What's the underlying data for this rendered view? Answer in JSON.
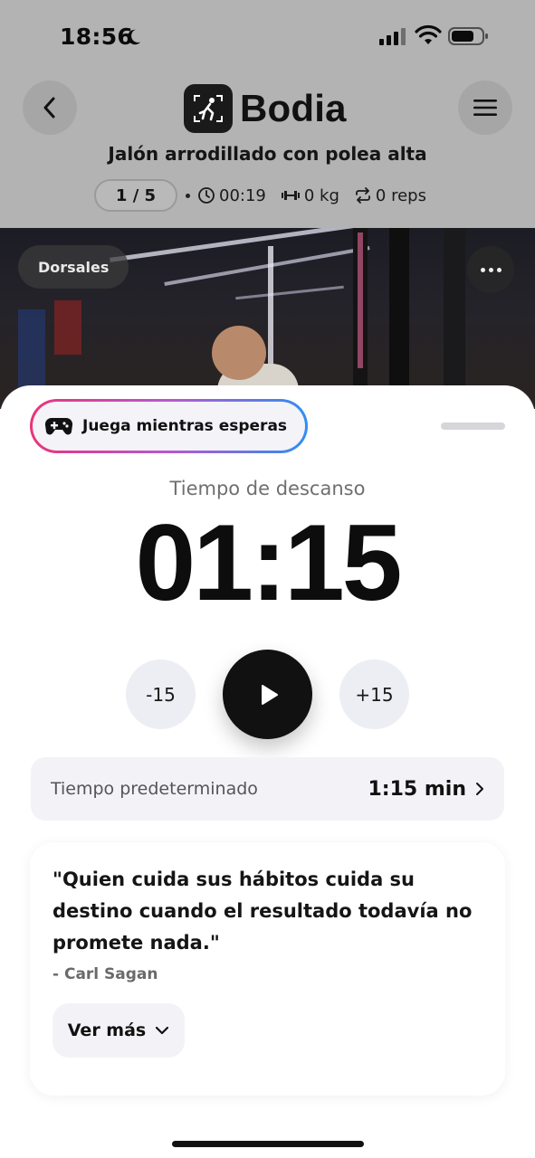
{
  "status_bar": {
    "time": "18:56"
  },
  "header": {
    "brand": "Bodia",
    "exercise_title": "Jalón arrodillado con polea alta",
    "set_counter": "1 / 5",
    "elapsed": "00:19",
    "weight": "0 kg",
    "reps": "0 reps"
  },
  "media": {
    "muscle_tag": "Dorsales"
  },
  "sheet": {
    "game_button_label": "Juega mientras esperas",
    "rest_label": "Tiempo de descanso",
    "timer": "01:15",
    "minus_label": "-15",
    "plus_label": "+15",
    "default_time_label": "Tiempo predeterminado",
    "default_time_value": "1:15 min"
  },
  "quote": {
    "text": "\"Quien cuida sus hábitos cuida su destino cuando el resultado todavía no promete nada.\"",
    "author": "- Carl Sagan",
    "more_label": "Ver más"
  },
  "icons": {
    "back": "chevron-left-icon",
    "menu": "hamburger-menu-icon",
    "clock": "clock-icon",
    "weight": "dumbbell-icon",
    "reps": "repeat-icon",
    "game": "gamepad-icon",
    "play": "play-icon",
    "more": "more-dots-icon"
  }
}
